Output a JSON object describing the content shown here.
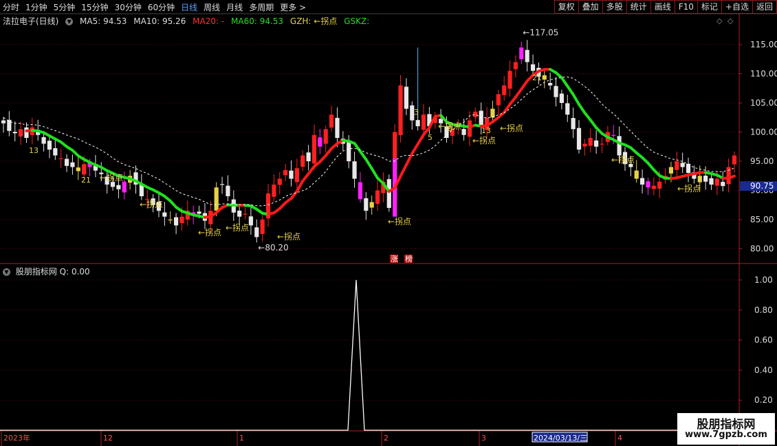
{
  "toolbar": {
    "periods": [
      "分时",
      "1分钟",
      "5分钟",
      "15分钟",
      "30分钟",
      "60分钟",
      "日线",
      "周线",
      "月线",
      "多周期",
      "更多 >"
    ],
    "active_period": "日线",
    "actions": [
      "复权",
      "叠加",
      "多股",
      "统计",
      "画线",
      "F10",
      "标记",
      "+自选",
      "返回"
    ]
  },
  "info": {
    "stock_name": "法拉电子(日线)",
    "ma5": "MA5: 94.53",
    "ma10": "MA10: 95.26",
    "ma20": "MA20: -",
    "ma60": "MA60: 94.53",
    "gzh": "GZH: ←拐点",
    "gskz": "GSKZ:"
  },
  "indicator": {
    "name": "股朋指标网",
    "q": "Q: 0.00"
  },
  "price_axis": {
    "ticks": [
      "115.00",
      "110.00",
      "105.00",
      "100.00",
      "95.00",
      "90.00",
      "85.00",
      "80.00"
    ],
    "current": "90.75"
  },
  "indicator_axis": {
    "ticks": [
      "1.00",
      "0.80",
      "0.60",
      "0.40",
      "0.20"
    ]
  },
  "time_axis": {
    "labels": [
      "2023年",
      "12",
      "1",
      "2",
      "3",
      "2024/03/13/三",
      "4"
    ]
  },
  "annotations": {
    "high": "117.05",
    "low": "80.20",
    "turn": "←拐点",
    "badges": [
      "涨",
      "榜"
    ],
    "counts": [
      "13",
      "21",
      "3",
      "5",
      "8",
      "13",
      "21"
    ]
  },
  "watermark": {
    "title": "股朋指标网",
    "url": "www.7gpzb.com"
  },
  "colors": {
    "up": "#ff2020",
    "down": "#e8e8e8",
    "ma_green": "#20e020",
    "ma_red": "#ff1a1a",
    "axis": "#b02020",
    "magenta": "#ff20ff",
    "yellow": "#e6d24a"
  }
}
